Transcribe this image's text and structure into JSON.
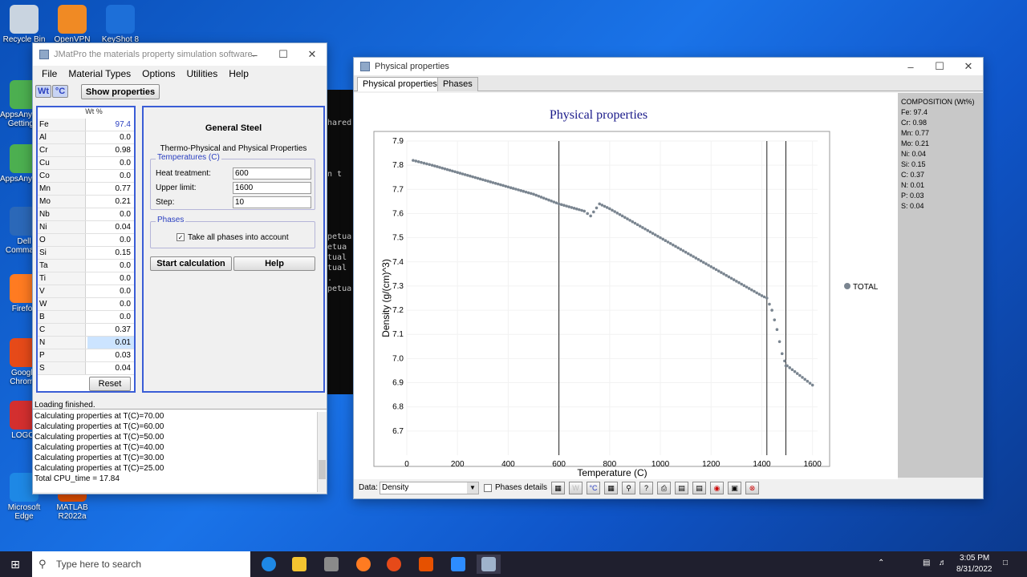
{
  "desktop": {
    "icons": [
      {
        "label": "Recycle Bin",
        "x": 0,
        "y": 6,
        "color": "#c9d4e0"
      },
      {
        "label": "OpenVPN",
        "x": 60,
        "y": 6,
        "color": "#f08a24"
      },
      {
        "label": "KeyShot 8",
        "x": 120,
        "y": 6,
        "color": "#1d6fd8"
      },
      {
        "label": "AppsAnywhere Getting...",
        "x": 0,
        "y": 100,
        "color": "#4caf50"
      },
      {
        "label": "AppsAnywhere",
        "x": 0,
        "y": 180,
        "color": "#4caf50"
      },
      {
        "label": "Dell Command",
        "x": 0,
        "y": 258,
        "color": "#2b68b8"
      },
      {
        "label": "Firefox",
        "x": 0,
        "y": 342,
        "color": "#ff7b21"
      },
      {
        "label": "Google Chrome",
        "x": 0,
        "y": 422,
        "color": "#e64a19"
      },
      {
        "label": "LOGO!",
        "x": 0,
        "y": 500,
        "color": "#d32f2f"
      },
      {
        "label": "Microsoft Edge",
        "x": 0,
        "y": 590,
        "color": "#1e88e5"
      },
      {
        "label": "MATLAB R2022a",
        "x": 60,
        "y": 590,
        "color": "#e65100"
      }
    ]
  },
  "console": {
    "lines": [
      {
        "text": "shared",
        "y": 36
      },
      {
        "text": " in t",
        "y": 100
      },
      {
        "text": "rpetua",
        "y": 178
      },
      {
        "text": "petua",
        "y": 191
      },
      {
        "text": "etual",
        "y": 204
      },
      {
        "text": "etual",
        "y": 217
      },
      {
        "text": ").",
        "y": 230
      },
      {
        "text": "rpetua",
        "y": 243
      }
    ]
  },
  "jmatpro": {
    "title": "JMatPro the materials property simulation software.",
    "menu": [
      "File",
      "Material Types",
      "Options",
      "Utilities",
      "Help"
    ],
    "toolbar": {
      "wt_label": "Wt",
      "c_label": "°C",
      "show_label": "Show properties"
    },
    "elements_header": "Wt %",
    "elements": [
      {
        "sym": "Fe",
        "val": "97.4"
      },
      {
        "sym": "Al",
        "val": "0.0"
      },
      {
        "sym": "Cr",
        "val": "0.98"
      },
      {
        "sym": "Cu",
        "val": "0.0"
      },
      {
        "sym": "Co",
        "val": "0.0"
      },
      {
        "sym": "Mn",
        "val": "0.77"
      },
      {
        "sym": "Mo",
        "val": "0.21"
      },
      {
        "sym": "Nb",
        "val": "0.0"
      },
      {
        "sym": "Ni",
        "val": "0.04"
      },
      {
        "sym": "O",
        "val": "0.0"
      },
      {
        "sym": "Si",
        "val": "0.15"
      },
      {
        "sym": "Ta",
        "val": "0.0"
      },
      {
        "sym": "Ti",
        "val": "0.0"
      },
      {
        "sym": "V",
        "val": "0.0"
      },
      {
        "sym": "W",
        "val": "0.0"
      },
      {
        "sym": "B",
        "val": "0.0"
      },
      {
        "sym": "C",
        "val": "0.37"
      },
      {
        "sym": "N",
        "val": "0.01"
      },
      {
        "sym": "P",
        "val": "0.03"
      },
      {
        "sym": "S",
        "val": "0.04"
      }
    ],
    "reset_label": "Reset",
    "panel_title": "General Steel",
    "panel_subtitle": "Thermo-Physical and Physical Properties",
    "temps_group": "Temperatures (C)",
    "heat_label": "Heat treatment:",
    "heat_value": "600",
    "upper_label": "Upper limit:",
    "upper_value": "1600",
    "step_label": "Step:",
    "step_value": "10",
    "phases_group": "Phases",
    "phases_check": "Take all phases into account",
    "start_label": "Start calculation",
    "help_label": "Help",
    "loading": "Loading finished.",
    "log": [
      "Calculating properties at T(C)=70.00",
      "Calculating properties at T(C)=60.00",
      "Calculating properties at T(C)=50.00",
      "Calculating properties at T(C)=40.00",
      "Calculating properties at T(C)=30.00",
      "Calculating properties at T(C)=25.00",
      "Total CPU_time = 17.84"
    ]
  },
  "physwin": {
    "title": "Physical properties",
    "tabs": [
      "Physical properties",
      "Phases"
    ],
    "composition": {
      "title": "COMPOSITION (Wt%)",
      "lines": [
        "Fe: 97.4",
        "Cr: 0.98",
        "Mn: 0.77",
        "Mo: 0.21",
        "Ni: 0.04",
        "Si: 0.15",
        "C: 0.37",
        "N: 0.01",
        "P: 0.03",
        "S: 0.04"
      ]
    },
    "data_label": "Data:",
    "data_value": "Density",
    "phases_details": "Phases details"
  },
  "chart_data": {
    "type": "scatter",
    "title": "Physical properties",
    "xlabel": "Temperature (C)",
    "ylabel": "Density (g/(cm)^3)",
    "xlim": [
      0,
      1620
    ],
    "ylim": [
      6.6,
      7.9
    ],
    "xticks": [
      0,
      200,
      400,
      600,
      800,
      1000,
      1200,
      1400,
      1600
    ],
    "yticks": [
      6.7,
      6.8,
      6.9,
      7.0,
      7.1,
      7.2,
      7.3,
      7.4,
      7.5,
      7.6,
      7.7,
      7.8,
      7.9
    ],
    "vlines": [
      600,
      1420,
      1495
    ],
    "legend": "TOTAL",
    "legend_position": "right",
    "series": [
      {
        "name": "TOTAL",
        "color": "#7a8590",
        "x": [
          25,
          100,
          200,
          300,
          400,
          500,
          600,
          700,
          725,
          760,
          800,
          900,
          1000,
          1100,
          1200,
          1300,
          1400,
          1420,
          1440,
          1460,
          1470,
          1480,
          1490,
          1495,
          1500,
          1550,
          1600
        ],
        "y": [
          7.82,
          7.8,
          7.77,
          7.74,
          7.71,
          7.68,
          7.64,
          7.61,
          7.59,
          7.64,
          7.62,
          7.56,
          7.5,
          7.44,
          7.38,
          7.32,
          7.26,
          7.25,
          7.2,
          7.12,
          7.07,
          7.02,
          6.99,
          6.97,
          6.97,
          6.93,
          6.89
        ]
      }
    ]
  },
  "taskbar": {
    "search_placeholder": "Type here to search",
    "time": "3:05 PM",
    "date": "8/31/2022"
  }
}
